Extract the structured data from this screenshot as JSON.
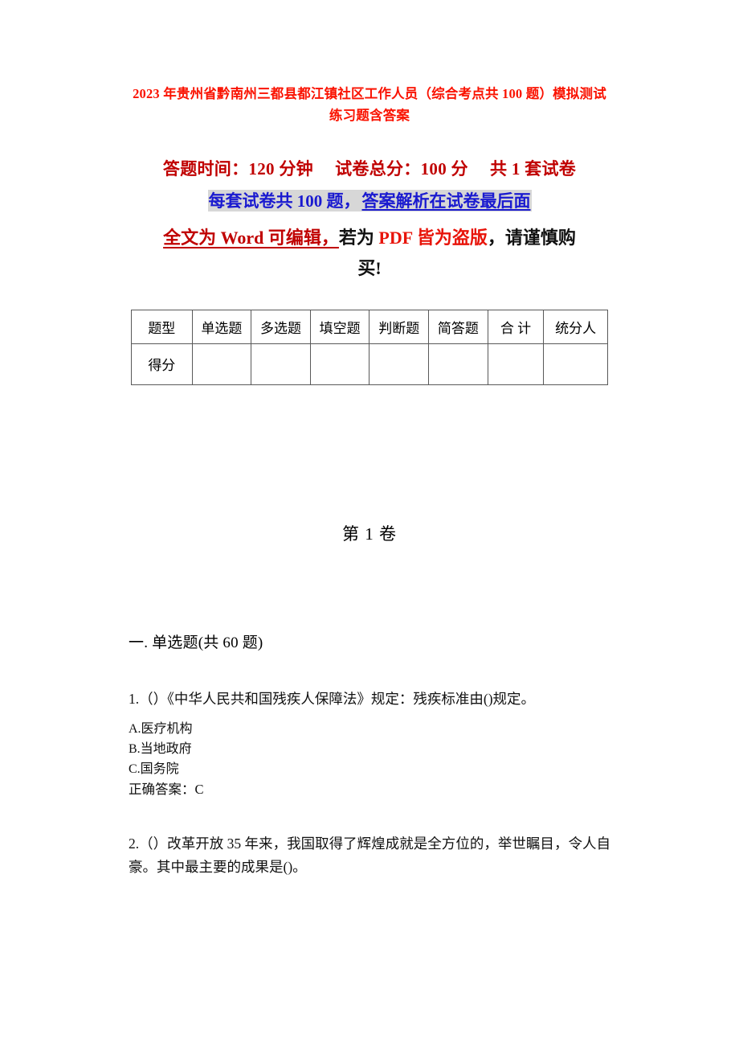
{
  "document": {
    "title": "2023 年贵州省黔南州三都县都江镇社区工作人员（综合考点共 100 题）模拟测试练习题含答案",
    "exam_time_label": "答题时间：120 分钟",
    "total_score_label": "试卷总分：100 分",
    "set_count_label": "共 1 套试卷",
    "count_line_part1": "每套试卷共 100 题，",
    "count_line_part2": "答案解析在试卷最后面",
    "warn_part1": "全文为 Word 可编辑，",
    "warn_part2": "若为 ",
    "warn_part3": "PDF 皆为盗版",
    "warn_part4": "，请谨慎购",
    "warn_part5": "买!",
    "volume_label": "第 1 卷"
  },
  "score_table": {
    "header": [
      "题型",
      "单选题",
      "多选题",
      "填空题",
      "判断题",
      "简答题",
      "合 计",
      "统分人"
    ],
    "rows": [
      {
        "label": "得分",
        "cells": [
          "",
          "",
          "",
          "",
          "",
          "",
          ""
        ]
      }
    ]
  },
  "sections": [
    {
      "heading": "一. 单选题(共 60 题)",
      "questions": [
        {
          "stem": "1.（）《中华人民共和国残疾人保障法》规定：残疾标准由()规定。",
          "options": [
            "A.医疗机构",
            "B.当地政府",
            "C.国务院"
          ],
          "answer": "正确答案：C"
        },
        {
          "stem": "2.（）改革开放 35 年来，我国取得了辉煌成就是全方位的，举世瞩目，令人自豪。其中最主要的成果是()。",
          "options": [],
          "answer": ""
        }
      ]
    }
  ],
  "colors": {
    "title_red": "#fa1200",
    "dark_red": "#c00000",
    "bright_red": "#e8140a",
    "blue": "#1a1ad0",
    "highlight_gray": "#d7d7d7",
    "black": "#111111",
    "table_border": "#595959"
  }
}
